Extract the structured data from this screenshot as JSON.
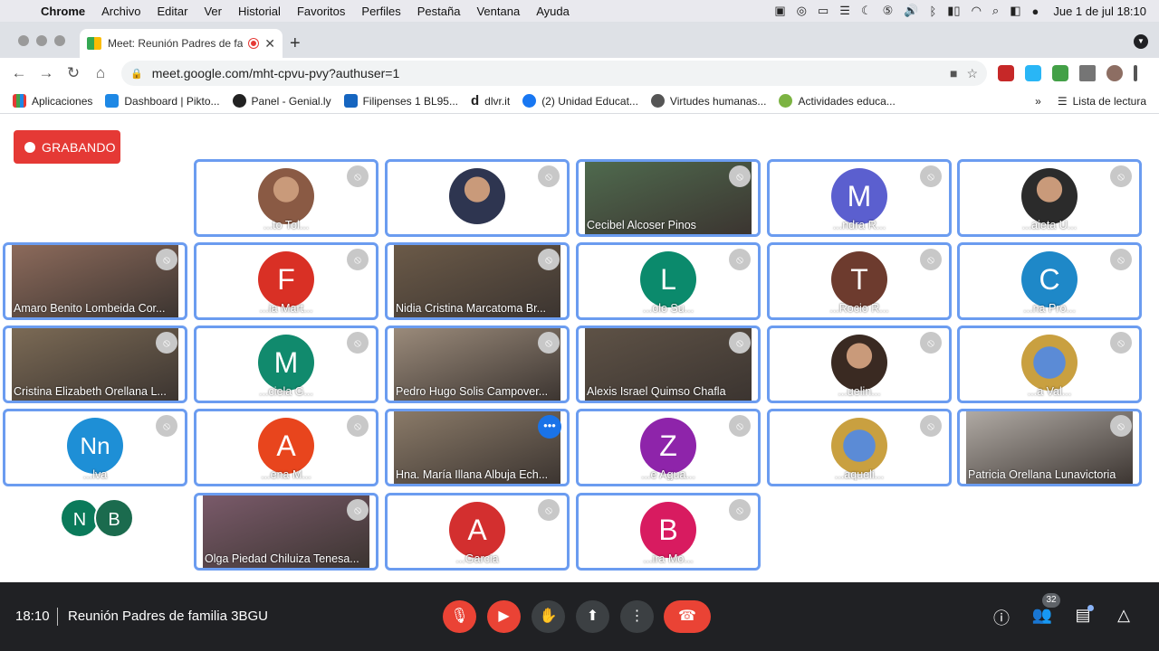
{
  "menubar": {
    "items": [
      "Chrome",
      "Archivo",
      "Editar",
      "Ver",
      "Historial",
      "Favoritos",
      "Perfiles",
      "Pestaña",
      "Ventana",
      "Ayuda"
    ],
    "clock": "Jue 1 de jul  18:10"
  },
  "browser": {
    "tab_title": "Meet: Reunión Padres de fa",
    "url": "meet.google.com/mht-cpvu-pvy?authuser=1"
  },
  "bookmarks": {
    "items": [
      "Aplicaciones",
      "Dashboard | Pikto...",
      "Panel - Genial.ly",
      "Filipenses 1 BL95...",
      "dlvr.it",
      "(2) Unidad Educat...",
      "Virtudes humanas...",
      "Actividades educa..."
    ],
    "reading_list": "Lista de lectura"
  },
  "meet": {
    "recording_label": "GRABANDO",
    "participants": [
      {
        "name": "...to Tol...",
        "type": "photo",
        "color": "#8a5a44"
      },
      {
        "name": "",
        "type": "photo",
        "color": "#2e3550"
      },
      {
        "name": "Cecibel Alcoser Pinos",
        "type": "video",
        "color": "#4f6a4e"
      },
      {
        "name": "...ndra R...",
        "type": "letter",
        "letter": "M",
        "color": "#5b5fcf"
      },
      {
        "name": "...aieta U...",
        "type": "photo",
        "color": "#2b2b2b"
      },
      {
        "name": "Amaro Benito Lombeida Cor...",
        "type": "video",
        "color": "#8c6a5b"
      },
      {
        "name": "...ia Mart...",
        "type": "letter",
        "letter": "F",
        "color": "#d93025"
      },
      {
        "name": "Nidia Cristina Marcatoma Br...",
        "type": "video",
        "color": "#6b5a48"
      },
      {
        "name": "...olo Su...",
        "type": "letter",
        "letter": "L",
        "color": "#0b8a6c"
      },
      {
        "name": "...Rocio R...",
        "type": "letter",
        "letter": "T",
        "color": "#6d3b2e"
      },
      {
        "name": "...na Pro...",
        "type": "letter",
        "letter": "C",
        "color": "#1e88c8"
      },
      {
        "name": "Cristina Elizabeth Orellana L...",
        "type": "video",
        "color": "#7b6a55"
      },
      {
        "name": "...ciela G...",
        "type": "letter",
        "letter": "M",
        "color": "#118a6d"
      },
      {
        "name": "Pedro Hugo Solis Campover...",
        "type": "video",
        "color": "#9a8a7a"
      },
      {
        "name": "Alexis Israel Quimso Chafla",
        "type": "video",
        "color": "#5e5246"
      },
      {
        "name": "...uelin...",
        "type": "photo",
        "color": "#3a2a22"
      },
      {
        "name": "...a Val...",
        "type": "logo",
        "color": "#c9a040"
      },
      {
        "name": "...lva",
        "type": "letter",
        "letter": "Nn",
        "color": "#1e8fd6"
      },
      {
        "name": "...ena M...",
        "type": "letter",
        "letter": "A",
        "color": "#e8451d"
      },
      {
        "name": "Hna. María Illana Albuja Ech...",
        "type": "video",
        "color": "#8a7a68"
      },
      {
        "name": "...e Agua...",
        "type": "letter",
        "letter": "Z",
        "color": "#8e24aa"
      },
      {
        "name": "...aqueli...",
        "type": "logo",
        "color": "#c9a040"
      },
      {
        "name": "Patricia Orellana Lunavictoria",
        "type": "video",
        "color": "#b0aaa4"
      },
      {
        "name": "Olga Piedad Chiluiza Tenesa...",
        "type": "video",
        "color": "#7a5a6a"
      },
      {
        "name": "...Garcia",
        "type": "letter",
        "letter": "A",
        "color": "#d32f2f"
      },
      {
        "name": "...ira Mo...",
        "type": "letter",
        "letter": "B",
        "color": "#d81b60"
      }
    ],
    "overflow_avatars": [
      "N",
      "B"
    ],
    "meeting_time": "18:10",
    "meeting_name": "Reunión Padres de familia 3BGU",
    "participant_count": "32"
  },
  "icons": {
    "mic_off": "mic-off-icon",
    "cam_off": "camera-off-icon",
    "hand": "raise-hand-icon",
    "present": "present-icon",
    "more": "more-options-icon",
    "hangup": "hangup-icon",
    "info": "info-icon",
    "people": "people-icon",
    "chat": "chat-icon",
    "activities": "activities-icon"
  }
}
